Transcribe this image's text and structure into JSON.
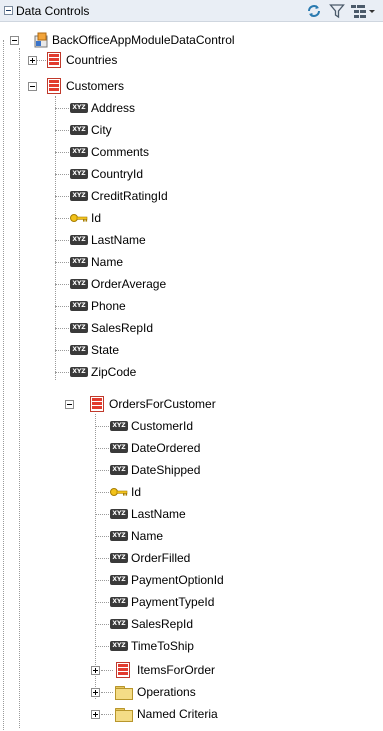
{
  "panel": {
    "title": "Data Controls",
    "toolbar": [
      {
        "icon": "refresh-icon"
      },
      {
        "icon": "filter-icon"
      },
      {
        "icon": "tree-options-icon"
      }
    ]
  },
  "tree": {
    "root": {
      "label": "BackOfficeAppModuleDataControl",
      "icon": "data-control-icon",
      "expanded": true
    },
    "countries": {
      "label": "Countries",
      "icon": "collection-icon",
      "expanded": false
    },
    "customers": {
      "label": "Customers",
      "icon": "collection-icon",
      "expanded": true
    },
    "customer_attrs": [
      {
        "label": "Address",
        "icon": "attribute-icon"
      },
      {
        "label": "City",
        "icon": "attribute-icon"
      },
      {
        "label": "Comments",
        "icon": "attribute-icon"
      },
      {
        "label": "CountryId",
        "icon": "attribute-icon"
      },
      {
        "label": "CreditRatingId",
        "icon": "attribute-icon"
      },
      {
        "label": "Id",
        "icon": "key-icon"
      },
      {
        "label": "LastName",
        "icon": "attribute-icon"
      },
      {
        "label": "Name",
        "icon": "attribute-icon"
      },
      {
        "label": "OrderAverage",
        "icon": "attribute-icon"
      },
      {
        "label": "Phone",
        "icon": "attribute-icon"
      },
      {
        "label": "SalesRepId",
        "icon": "attribute-icon"
      },
      {
        "label": "State",
        "icon": "attribute-icon"
      },
      {
        "label": "ZipCode",
        "icon": "attribute-icon"
      }
    ],
    "orders": {
      "label": "OrdersForCustomer",
      "icon": "collection-icon",
      "expanded": true
    },
    "order_attrs": [
      {
        "label": "CustomerId",
        "icon": "attribute-icon"
      },
      {
        "label": "DateOrdered",
        "icon": "attribute-icon"
      },
      {
        "label": "DateShipped",
        "icon": "attribute-icon"
      },
      {
        "label": "Id",
        "icon": "key-icon"
      },
      {
        "label": "LastName",
        "icon": "attribute-icon"
      },
      {
        "label": "Name",
        "icon": "attribute-icon"
      },
      {
        "label": "OrderFilled",
        "icon": "attribute-icon"
      },
      {
        "label": "PaymentOptionId",
        "icon": "attribute-icon"
      },
      {
        "label": "PaymentTypeId",
        "icon": "attribute-icon"
      },
      {
        "label": "SalesRepId",
        "icon": "attribute-icon"
      },
      {
        "label": "TimeToShip",
        "icon": "attribute-icon"
      }
    ],
    "order_children": [
      {
        "label": "ItemsForOrder",
        "icon": "collection-icon",
        "expanded": false
      },
      {
        "label": "Operations",
        "icon": "folder-icon",
        "expanded": false
      },
      {
        "label": "Named Criteria",
        "icon": "folder-icon",
        "expanded": false
      }
    ]
  },
  "colors": {
    "header_bg": "#e9eef5",
    "collection_red": "#e23b2e",
    "key_gold": "#d8a800"
  }
}
